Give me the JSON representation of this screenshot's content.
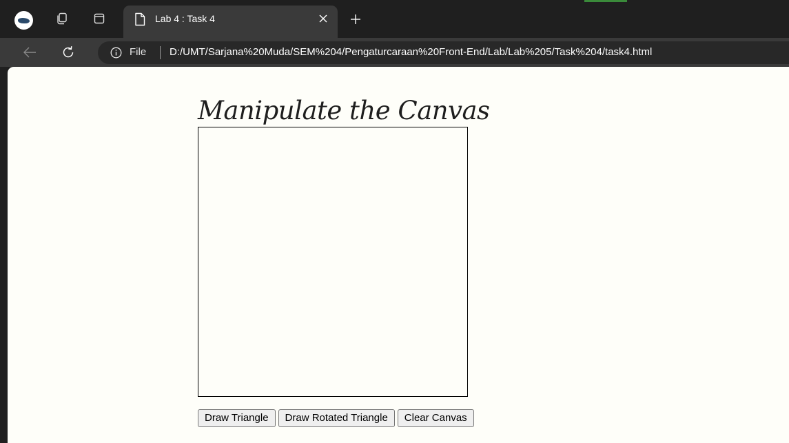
{
  "browser": {
    "tab": {
      "title": "Lab 4 : Task 4"
    },
    "address_bar": {
      "scheme_label": "File",
      "url": "D:/UMT/Sarjana%20Muda/SEM%204/Pengaturcaraan%20Front-End/Lab/Lab%205/Task%204/task4.html"
    },
    "icons": {
      "profile": "profile-avatar-icon",
      "collections": "collections-icon",
      "tab_actions": "tab-actions-icon",
      "tab_page": "document-icon",
      "tab_close": "close-icon",
      "new_tab": "plus-icon",
      "back": "back-arrow-icon",
      "reload": "reload-icon",
      "site_info": "info-icon"
    },
    "colors": {
      "tabstrip_bg": "#1f1f1f",
      "tab_active_bg": "#3a3a3a",
      "toolbar_bg": "#3a3a3a",
      "omnibox_bg": "#282828",
      "page_bg": "#fefef9"
    }
  },
  "page": {
    "heading": "Manipulate the Canvas",
    "buttons": [
      {
        "label": "Draw Triangle"
      },
      {
        "label": "Draw Rotated Triangle"
      },
      {
        "label": "Clear Canvas"
      }
    ]
  }
}
